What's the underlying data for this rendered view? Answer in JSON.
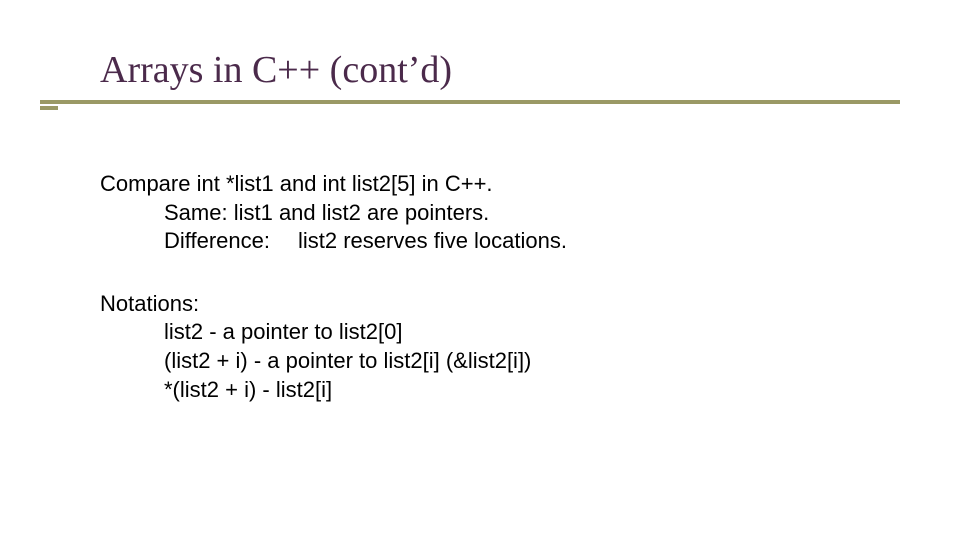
{
  "title": "Arrays in C++ (cont’d)",
  "body": {
    "compare": {
      "line1": "Compare int *list1 and int list2[5] in C++.",
      "same_label": "Same:",
      "same_text": " list1 and list2 are pointers.",
      "diff_label": "Difference:",
      "diff_text": "list2 reserves five locations."
    },
    "notations": {
      "heading": "Notations:",
      "lines": [
        "list2 - a pointer to list2[0]",
        "(list2 + i) - a pointer to list2[i] (&list2[i])",
        "*(list2 + i) - list2[i]"
      ]
    }
  }
}
